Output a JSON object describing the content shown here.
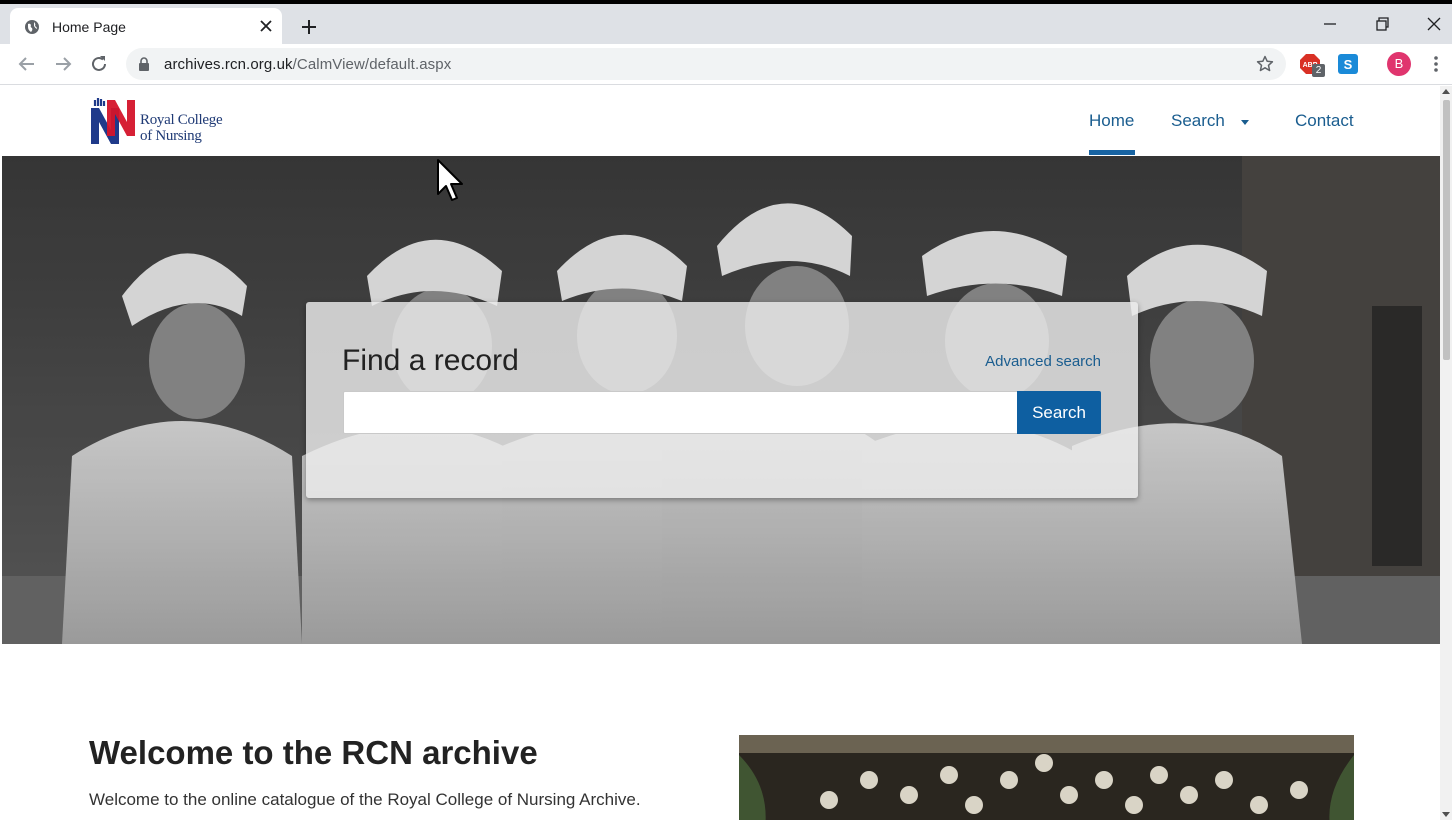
{
  "browser": {
    "tab_title": "Home Page",
    "url_host": "archives.rcn.org.uk",
    "url_path": "/CalmView/default.aspx",
    "extension_badge": "2",
    "profile_initial": "B",
    "icons": [
      "globe-icon",
      "close-icon",
      "plus-icon",
      "back-icon",
      "forward-icon",
      "reload-icon",
      "lock-icon",
      "star-icon",
      "adblock-icon",
      "skype-icon",
      "more-vert-icon",
      "minimize-icon",
      "restore-icon",
      "window-close-icon"
    ]
  },
  "site": {
    "logo_line1": "Royal College",
    "logo_line2": "of Nursing",
    "nav": {
      "home": "Home",
      "search": "Search",
      "contact": "Contact"
    },
    "accent_color": "#0e5fa1"
  },
  "hero": {
    "search_title": "Find a record",
    "advanced_link": "Advanced search",
    "input_value": "",
    "search_button": "Search"
  },
  "welcome": {
    "title": "Welcome to the RCN archive",
    "text": "Welcome to the online catalogue of the Royal College of Nursing Archive."
  }
}
